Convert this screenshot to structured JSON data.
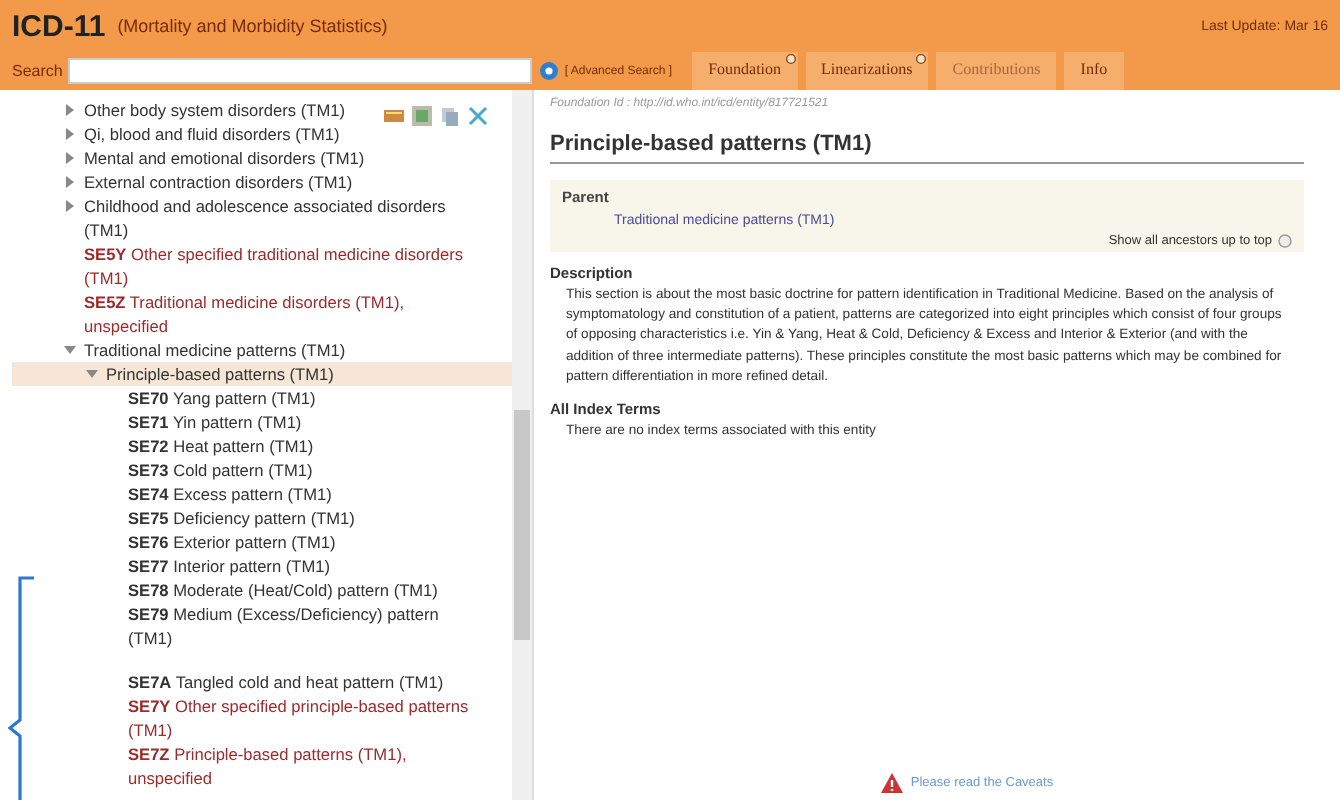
{
  "header": {
    "title": "ICD-11",
    "subtitle": "(Mortality and Morbidity Statistics)",
    "last_update": "Last Update: Mar 16"
  },
  "search": {
    "label": "Search",
    "advanced": "[ Advanced Search ]"
  },
  "tabs": [
    {
      "label": "Foundation",
      "disabled": false,
      "help": true
    },
    {
      "label": "Linearizations",
      "disabled": false,
      "help": true
    },
    {
      "label": "Contributions",
      "disabled": true,
      "help": false
    },
    {
      "label": "Info",
      "disabled": false,
      "help": false
    }
  ],
  "tree": [
    {
      "label": "Other body system disorders (TM1)",
      "kind": "entity",
      "expanded": false,
      "selected": false
    },
    {
      "label": "Qi, blood and fluid disorders (TM1)",
      "kind": "entity",
      "expanded": false,
      "selected": false
    },
    {
      "label": "Mental and emotional disorders (TM1)",
      "kind": "entity",
      "expanded": false,
      "selected": false
    },
    {
      "label": "External contraction disorders (TM1)",
      "kind": "entity",
      "expanded": false,
      "selected": false
    },
    {
      "label": "Childhood and adolescence associated disorders (TM1)",
      "kind": "entity",
      "expanded": false,
      "selected": false
    },
    {
      "code": "SE5Y",
      "label": "Other specified traditional medicine disorders (TM1)",
      "kind": "residual",
      "selected": false
    },
    {
      "code": "SE5Z",
      "label": "Traditional medicine disorders (TM1), unspecified",
      "kind": "residual",
      "selected": false
    },
    {
      "label": "Traditional medicine patterns (TM1)",
      "kind": "entity",
      "expanded": true,
      "selected": false,
      "children": [
        {
          "label": "Principle-based patterns (TM1)",
          "kind": "entity",
          "expanded": true,
          "selected": true,
          "children": [
            {
              "code": "SE70",
              "label": "Yang pattern (TM1)",
              "kind": "entity",
              "selected": false
            },
            {
              "code": "SE71",
              "label": "Yin pattern (TM1)",
              "kind": "entity",
              "selected": false
            },
            {
              "code": "SE72",
              "label": "Heat pattern (TM1)",
              "kind": "entity",
              "selected": false
            },
            {
              "code": "SE73",
              "label": "Cold pattern (TM1)",
              "kind": "entity",
              "selected": false
            },
            {
              "code": "SE74",
              "label": "Excess pattern (TM1)",
              "kind": "entity",
              "selected": false
            },
            {
              "code": "SE75",
              "label": "Deficiency pattern (TM1)",
              "kind": "entity",
              "selected": false
            },
            {
              "code": "SE76",
              "label": "Exterior pattern (TM1)",
              "kind": "entity",
              "selected": false
            },
            {
              "code": "SE77",
              "label": "Interior pattern (TM1)",
              "kind": "entity",
              "selected": false
            },
            {
              "code": "SE78",
              "label": "Moderate (Heat/Cold) pattern (TM1)",
              "kind": "entity",
              "selected": false
            },
            {
              "code": "SE79",
              "label": "Medium (Excess/Deficiency) pattern (TM1)",
              "kind": "entity",
              "selected": false,
              "gap_after": true
            },
            {
              "code": "SE7A",
              "label": "Tangled cold and heat pattern (TM1)",
              "kind": "entity",
              "selected": false
            },
            {
              "code": "SE7Y",
              "label": "Other specified principle-based patterns (TM1)",
              "kind": "residual",
              "selected": false
            },
            {
              "code": "SE7Z",
              "label": "Principle-based patterns (TM1), unspecified",
              "kind": "residual",
              "selected": false
            }
          ]
        }
      ]
    }
  ],
  "detail": {
    "foundation_id": "Foundation Id : http://id.who.int/icd/entity/817721521",
    "title": "Principle-based patterns (TM1)",
    "parent_heading": "Parent",
    "parent_link": "Traditional medicine patterns (TM1)",
    "ancestors": "Show all ancestors up to top",
    "description_heading": "Description",
    "description": "This section is about the most basic doctrine for pattern identification in Traditional Medicine. Based on the analysis of symptomatology and constitution of a patient, patterns are categorized into eight principles which consist of four groups of opposing characteristics i.e. Yin & Yang, Heat & Cold, Deficiency & Excess and Interior & Exterior (and with the addition of three intermediate patterns). These principles constitute the most basic patterns which may be combined for pattern differentiation in more refined detail.",
    "index_heading": "All Index Terms",
    "index_text": "There are no index terms associated with this entity",
    "caveats": "Please read the Caveats"
  }
}
